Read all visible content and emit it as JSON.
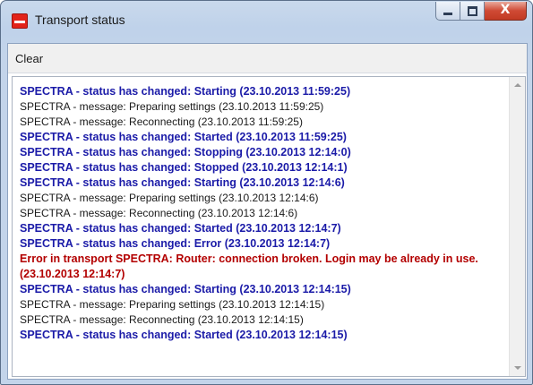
{
  "window": {
    "title": "Transport status",
    "icon": "app-logo-icon",
    "caption_buttons": {
      "minimize": "minimize-icon",
      "maximize": "maximize-icon",
      "close": "close-icon",
      "close_glyph": "X"
    }
  },
  "menu": {
    "clear_label": "Clear"
  },
  "colors": {
    "status": "#1b1ba8",
    "message": "#1a1a1a",
    "error": "#b30000"
  },
  "log": {
    "lines": [
      {
        "type": "status",
        "text": "SPECTRA - status has changed: Starting (23.10.2013 11:59:25)"
      },
      {
        "type": "message",
        "text": "SPECTRA - message: Preparing settings (23.10.2013 11:59:25)"
      },
      {
        "type": "message",
        "text": "SPECTRA - message: Reconnecting (23.10.2013 11:59:25)"
      },
      {
        "type": "status",
        "text": "SPECTRA - status has changed: Started (23.10.2013 11:59:25)"
      },
      {
        "type": "status",
        "text": "SPECTRA - status has changed: Stopping (23.10.2013 12:14:0)"
      },
      {
        "type": "status",
        "text": "SPECTRA - status has changed: Stopped (23.10.2013 12:14:1)"
      },
      {
        "type": "status",
        "text": "SPECTRA - status has changed: Starting (23.10.2013 12:14:6)"
      },
      {
        "type": "message",
        "text": "SPECTRA - message: Preparing settings (23.10.2013 12:14:6)"
      },
      {
        "type": "message",
        "text": "SPECTRA - message: Reconnecting (23.10.2013 12:14:6)"
      },
      {
        "type": "status",
        "text": "SPECTRA - status has changed: Started (23.10.2013 12:14:7)"
      },
      {
        "type": "status",
        "text": "SPECTRA - status has changed: Error (23.10.2013 12:14:7)"
      },
      {
        "type": "error",
        "text": "Error in transport SPECTRA: Router: connection broken. Login may be already in use. (23.10.2013 12:14:7)"
      },
      {
        "type": "status",
        "text": "SPECTRA - status has changed: Starting (23.10.2013 12:14:15)"
      },
      {
        "type": "message",
        "text": "SPECTRA - message: Preparing settings (23.10.2013 12:14:15)"
      },
      {
        "type": "message",
        "text": "SPECTRA - message: Reconnecting (23.10.2013 12:14:15)"
      },
      {
        "type": "status",
        "text": "SPECTRA - status has changed: Started (23.10.2013 12:14:15)"
      }
    ]
  }
}
